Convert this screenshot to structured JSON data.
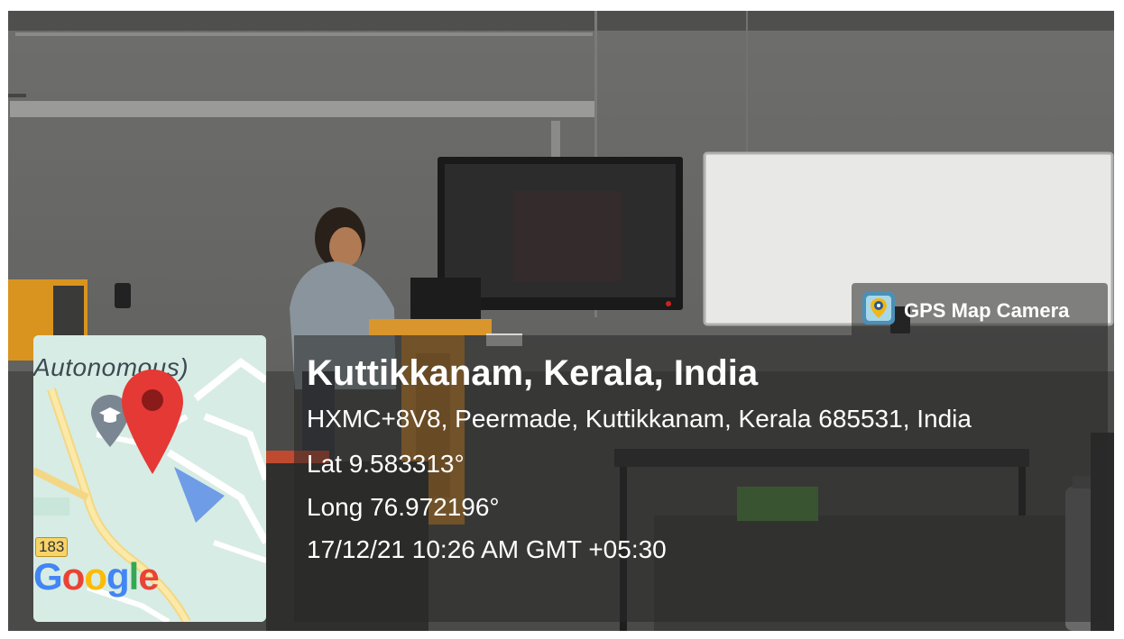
{
  "overlay": {
    "app_name": "GPS Map Camera",
    "place": "Kuttikkanam, Kerala, India",
    "address": "HXMC+8V8, Peermade, Kuttikkanam, Kerala 685531, India",
    "latitude": "Lat 9.583313°",
    "longitude": "Long 76.972196°",
    "datetime": "17/12/21 10:26 AM GMT +05:30"
  },
  "map": {
    "place_label": "Autonomous)",
    "road_number": "183",
    "google_logo": "Google",
    "pin_color": "#e53935",
    "map_background": "#d7ece4"
  },
  "colors": {
    "overlay_text": "#ffffff",
    "overlay_panel": "rgba(40,40,40,0.55)"
  }
}
